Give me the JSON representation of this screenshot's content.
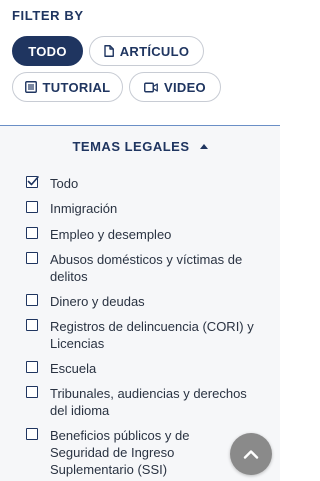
{
  "filter": {
    "title": "FILTER BY"
  },
  "content_types": [
    {
      "label": "TODO",
      "active": true,
      "icon": "none"
    },
    {
      "label": "ARTÍCULO",
      "active": false,
      "icon": "document-icon"
    },
    {
      "label": "TUTORIAL",
      "active": false,
      "icon": "list-icon"
    },
    {
      "label": "VIDEO",
      "active": false,
      "icon": "video-icon"
    }
  ],
  "topics": {
    "header": "TEMAS LEGALES",
    "expanded": true,
    "options": [
      {
        "label": "Todo",
        "checked": true
      },
      {
        "label": "Inmigración",
        "checked": false
      },
      {
        "label": "Empleo y desempleo",
        "checked": false
      },
      {
        "label": "Abusos domésticos y víctimas de delitos",
        "checked": false
      },
      {
        "label": "Dinero y deudas",
        "checked": false
      },
      {
        "label": "Registros de delincuencia (CORI) y Licencias",
        "checked": false
      },
      {
        "label": "Escuela",
        "checked": false
      },
      {
        "label": "Tribunales, audiencias y derechos del idioma",
        "checked": false
      },
      {
        "label": "Beneficios públicos y de Seguridad de Ingreso Suplementario (SSI)",
        "checked": false
      }
    ]
  },
  "scroll_top": {
    "icon": "chevron-up-icon"
  },
  "colors": {
    "navy": "#1f3560",
    "pill_border": "#c8ccd4",
    "divider": "#6a8fc6",
    "fab": "#8a8a8a"
  }
}
